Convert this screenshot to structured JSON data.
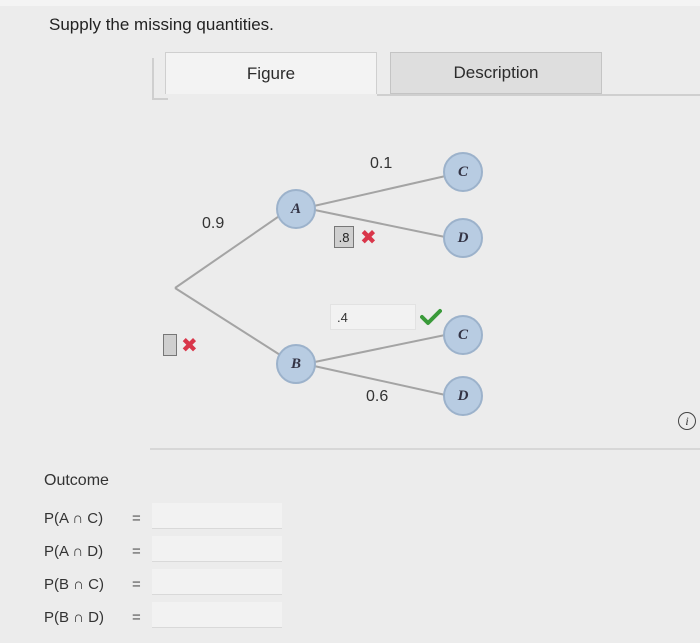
{
  "instruction": "Supply the missing quantities.",
  "tabs": {
    "figure": "Figure",
    "description": "Description"
  },
  "tree": {
    "node_a": "A",
    "node_b": "B",
    "node_ac": "C",
    "node_ad": "D",
    "node_bc": "C",
    "node_bd": "D",
    "prob_a": "0.9",
    "prob_ac": "0.1",
    "prob_bd": "0.6",
    "input_b_value": "",
    "input_ad_value": ".8",
    "input_bc_value": ".4"
  },
  "status": {
    "incorrect_symbol": "✖",
    "correct_color": "#3a9a3a",
    "incorrect_color": "#d9364a"
  },
  "info_icon_label": "i",
  "outcomes": {
    "header": "Outcome",
    "rows": [
      {
        "label": "P(A ∩ C)",
        "eq": "=",
        "value": ""
      },
      {
        "label": "P(A ∩ D)",
        "eq": "=",
        "value": ""
      },
      {
        "label": "P(B ∩ C)",
        "eq": "=",
        "value": ""
      },
      {
        "label": "P(B ∩ D)",
        "eq": "=",
        "value": ""
      }
    ]
  }
}
